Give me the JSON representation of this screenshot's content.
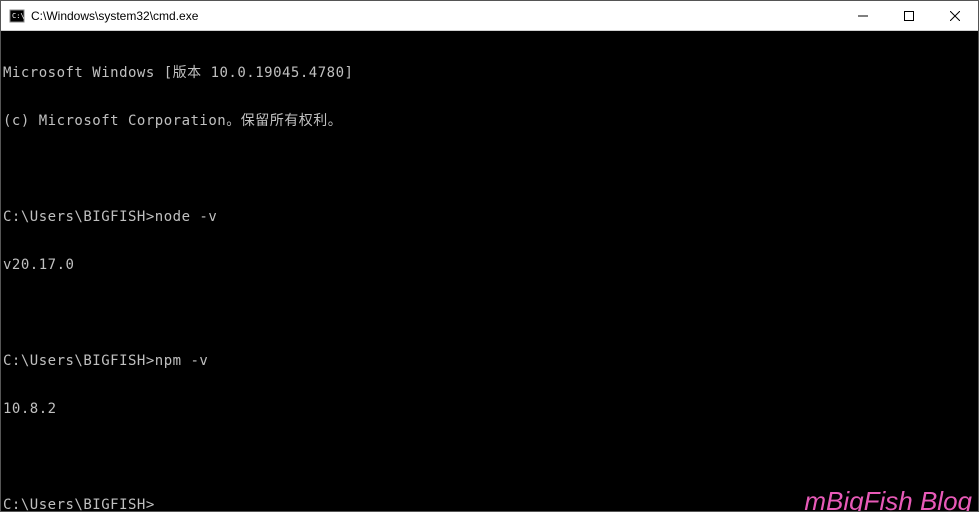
{
  "window": {
    "title": "C:\\Windows\\system32\\cmd.exe"
  },
  "terminal": {
    "lines": [
      "Microsoft Windows [版本 10.0.19045.4780]",
      "(c) Microsoft Corporation。保留所有权利。",
      "",
      "C:\\Users\\BIGFISH>node -v",
      "v20.17.0",
      "",
      "C:\\Users\\BIGFISH>npm -v",
      "10.8.2",
      "",
      "C:\\Users\\BIGFISH>"
    ]
  },
  "watermark": "mBigFish Blog"
}
